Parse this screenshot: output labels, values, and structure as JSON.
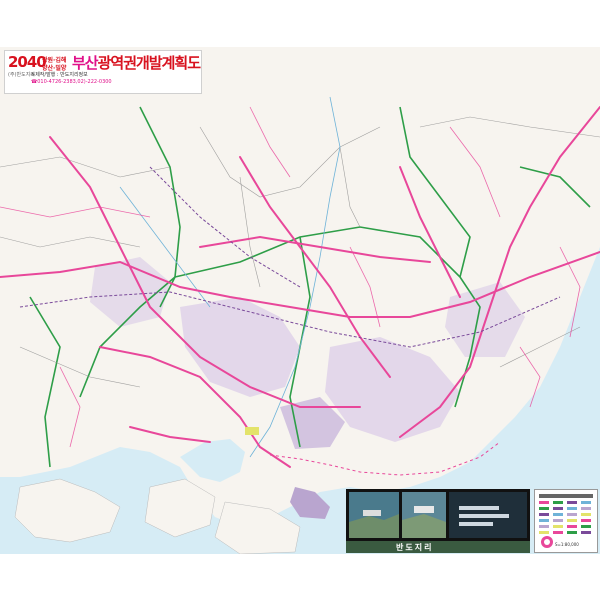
{
  "map": {
    "title_year": "2040",
    "title_cities_line1": "창원·김해",
    "title_cities_line2": "양산·밀양",
    "title_city": "부산",
    "title_rest": "광역권개발계획도",
    "title_sub": "(주)반도지리",
    "publisher_line1": "※제작/발행 : 반도지리정보",
    "publisher_line2": "☎010-4726-2383,02)-222-0300",
    "logo_text": "반도지리",
    "scale": "S=1:80,000",
    "colors": {
      "land": "#f7f4ef",
      "sea": "#d6ecf5",
      "road": "#e8479a",
      "boundary": "#2e9e48",
      "rail": "#7a4a9a",
      "title_red": "#d8121f",
      "title_magenta": "#e0108a"
    }
  }
}
